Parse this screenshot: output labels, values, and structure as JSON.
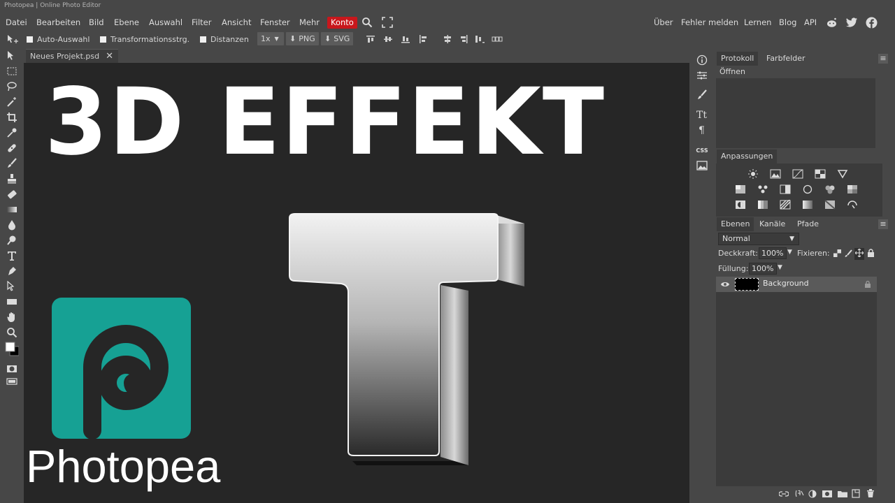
{
  "window_title": "Photopea | Online Photo Editor",
  "menu": {
    "items": [
      "Datei",
      "Bearbeiten",
      "Bild",
      "Ebene",
      "Auswahl",
      "Filter",
      "Ansicht",
      "Fenster",
      "Mehr"
    ],
    "account": "Konto",
    "right_links": [
      "Über",
      "Fehler melden",
      "Lernen",
      "Blog",
      "API"
    ]
  },
  "options": {
    "auto_select": "Auto-Auswahl",
    "transform": "Transformationsstrg.",
    "distances": "Distanzen",
    "zoom": "1x",
    "png": "PNG",
    "svg": "SVG"
  },
  "document": {
    "tab_name": "Neues Projekt.psd",
    "close": "✕"
  },
  "canvas": {
    "headline": "3D EFFEKT",
    "logo_text": "Photopea"
  },
  "panels": {
    "history_tabs": [
      "Protokoll",
      "Farbfelder"
    ],
    "history_items": [
      "Öffnen"
    ],
    "adjustments_tab": "Anpassungen",
    "layers_tabs": [
      "Ebenen",
      "Kanäle",
      "Pfade"
    ],
    "blend_mode": "Normal",
    "opacity_label": "Deckkraft:",
    "opacity_value": "100%",
    "lock_label": "Fixieren:",
    "fill_label": "Füllung:",
    "fill_value": "100%",
    "layer_name": "Background",
    "mini_css": "CSS"
  },
  "colors": {
    "accent": "#c8171c",
    "logo_teal": "#16a194",
    "canvas_bg": "#262626",
    "ui_bg": "#474747"
  }
}
